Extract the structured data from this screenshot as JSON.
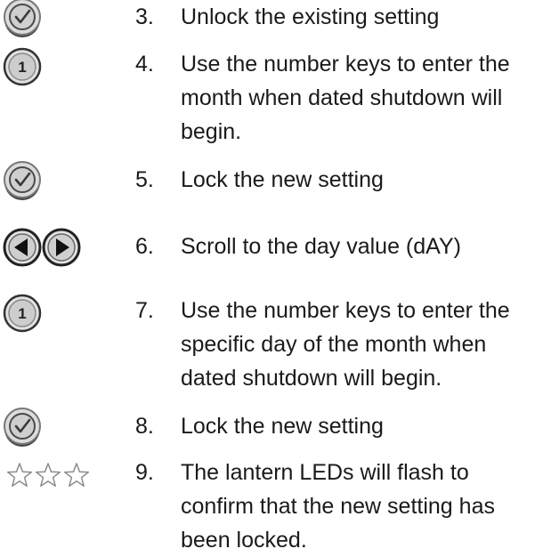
{
  "steps": [
    {
      "number": "3.",
      "text": "Unlock the existing setting",
      "icon": "check-button-icon"
    },
    {
      "number": "4.",
      "text": "Use the number keys to enter the month when dated shutdown will begin.",
      "icon": "number-key-1-icon",
      "key_label": "1"
    },
    {
      "number": "5.",
      "text": "Lock the new setting",
      "icon": "check-button-icon"
    },
    {
      "number": "6.",
      "text": "Scroll to the day value (dAY)",
      "icon": "scroll-left-right-icons"
    },
    {
      "number": "7.",
      "text": "Use the number keys to enter the specific day of the month when dated shutdown will begin.",
      "icon": "number-key-1-icon",
      "key_label": "1"
    },
    {
      "number": "8.",
      "text": "Lock the new setting",
      "icon": "check-button-icon"
    },
    {
      "number": "9.",
      "text": "The lantern LEDs will flash to confirm that the new setting has been locked.",
      "icon": "flashing-stars-icon"
    }
  ],
  "colors": {
    "text": "#1a1a1a",
    "button_fill": "#c8c8c8",
    "button_ring": "#555555",
    "star_outline": "#8c8c8c"
  }
}
